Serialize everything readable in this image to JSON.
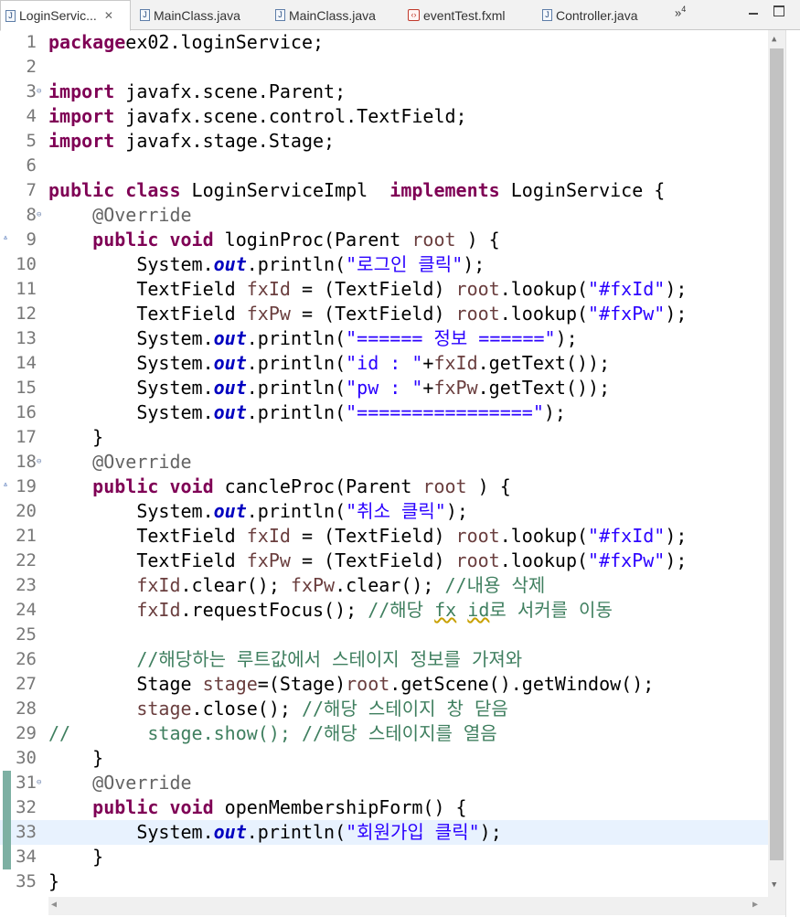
{
  "tabs": [
    {
      "label": "LoginServic...",
      "icon": "java-file-icon",
      "active": true,
      "close": "✕"
    },
    {
      "label": "MainClass.java",
      "icon": "java-file-icon"
    },
    {
      "label": "MainClass.java",
      "icon": "java-file-icon"
    },
    {
      "label": "eventTest.fxml",
      "icon": "fxml-file-icon"
    },
    {
      "label": "Controller.java",
      "icon": "java-file-icon"
    }
  ],
  "overflow_count": "4",
  "editor": {
    "current_line": 33,
    "lines": [
      {
        "n": "1",
        "code": [
          [
            "kw",
            "package"
          ],
          [
            "",
            "ex02.loginService;"
          ]
        ]
      },
      {
        "n": "2",
        "code": []
      },
      {
        "n": "3",
        "fold": true,
        "code": [
          [
            "kw",
            "import"
          ],
          [
            "",
            " javafx.scene.Parent;"
          ]
        ]
      },
      {
        "n": "4",
        "code": [
          [
            "kw",
            "import"
          ],
          [
            "",
            " javafx.scene.control.TextField;"
          ]
        ]
      },
      {
        "n": "5",
        "code": [
          [
            "kw",
            "import"
          ],
          [
            "",
            " javafx.stage.Stage;"
          ]
        ]
      },
      {
        "n": "6",
        "code": []
      },
      {
        "n": "7",
        "code": [
          [
            "kw",
            "public"
          ],
          [
            "",
            " "
          ],
          [
            "kw",
            "class"
          ],
          [
            "",
            " LoginServiceImpl  "
          ],
          [
            "kw",
            "implements"
          ],
          [
            "",
            " LoginService {"
          ]
        ]
      },
      {
        "n": "8",
        "fold": true,
        "code": [
          [
            "",
            "    "
          ],
          [
            "ann",
            "@Override"
          ]
        ]
      },
      {
        "n": "9",
        "override": true,
        "code": [
          [
            "",
            "    "
          ],
          [
            "kw",
            "public"
          ],
          [
            "",
            " "
          ],
          [
            "kw",
            "void"
          ],
          [
            "",
            " loginProc(Parent "
          ],
          [
            "var",
            "root"
          ],
          [
            "",
            " ) {"
          ]
        ]
      },
      {
        "n": "10",
        "code": [
          [
            "",
            "        System."
          ],
          [
            "fld",
            "out"
          ],
          [
            "",
            ".println("
          ],
          [
            "str",
            "\"로그인 클릭\""
          ],
          [
            "",
            ");"
          ]
        ]
      },
      {
        "n": "11",
        "code": [
          [
            "",
            "        TextField "
          ],
          [
            "var",
            "fxId"
          ],
          [
            "",
            " = (TextField) "
          ],
          [
            "var",
            "root"
          ],
          [
            "",
            ".lookup("
          ],
          [
            "str",
            "\"#fxId\""
          ],
          [
            "",
            ");"
          ]
        ]
      },
      {
        "n": "12",
        "code": [
          [
            "",
            "        TextField "
          ],
          [
            "var",
            "fxPw"
          ],
          [
            "",
            " = (TextField) "
          ],
          [
            "var",
            "root"
          ],
          [
            "",
            ".lookup("
          ],
          [
            "str",
            "\"#fxPw\""
          ],
          [
            "",
            ");"
          ]
        ]
      },
      {
        "n": "13",
        "code": [
          [
            "",
            "        System."
          ],
          [
            "fld",
            "out"
          ],
          [
            "",
            ".println("
          ],
          [
            "str",
            "\"====== 정보 ======\""
          ],
          [
            "",
            ");"
          ]
        ]
      },
      {
        "n": "14",
        "code": [
          [
            "",
            "        System."
          ],
          [
            "fld",
            "out"
          ],
          [
            "",
            ".println("
          ],
          [
            "str",
            "\"id : \""
          ],
          [
            "",
            "+"
          ],
          [
            "var",
            "fxId"
          ],
          [
            "",
            ".getText());"
          ]
        ]
      },
      {
        "n": "15",
        "code": [
          [
            "",
            "        System."
          ],
          [
            "fld",
            "out"
          ],
          [
            "",
            ".println("
          ],
          [
            "str",
            "\"pw : \""
          ],
          [
            "",
            "+"
          ],
          [
            "var",
            "fxPw"
          ],
          [
            "",
            ".getText());"
          ]
        ]
      },
      {
        "n": "16",
        "code": [
          [
            "",
            "        System."
          ],
          [
            "fld",
            "out"
          ],
          [
            "",
            ".println("
          ],
          [
            "str",
            "\"================\""
          ],
          [
            "",
            ");"
          ]
        ]
      },
      {
        "n": "17",
        "code": [
          [
            "",
            "    }"
          ]
        ]
      },
      {
        "n": "18",
        "fold": true,
        "code": [
          [
            "",
            "    "
          ],
          [
            "ann",
            "@Override"
          ]
        ]
      },
      {
        "n": "19",
        "override": true,
        "code": [
          [
            "",
            "    "
          ],
          [
            "kw",
            "public"
          ],
          [
            "",
            " "
          ],
          [
            "kw",
            "void"
          ],
          [
            "",
            " cancleProc(Parent "
          ],
          [
            "var",
            "root"
          ],
          [
            "",
            " ) {"
          ]
        ]
      },
      {
        "n": "20",
        "code": [
          [
            "",
            "        System."
          ],
          [
            "fld",
            "out"
          ],
          [
            "",
            ".println("
          ],
          [
            "str",
            "\"취소 클릭\""
          ],
          [
            "",
            ");"
          ]
        ]
      },
      {
        "n": "21",
        "code": [
          [
            "",
            "        TextField "
          ],
          [
            "var",
            "fxId"
          ],
          [
            "",
            " = (TextField) "
          ],
          [
            "var",
            "root"
          ],
          [
            "",
            ".lookup("
          ],
          [
            "str",
            "\"#fxId\""
          ],
          [
            "",
            ");"
          ]
        ]
      },
      {
        "n": "22",
        "code": [
          [
            "",
            "        TextField "
          ],
          [
            "var",
            "fxPw"
          ],
          [
            "",
            " = (TextField) "
          ],
          [
            "var",
            "root"
          ],
          [
            "",
            ".lookup("
          ],
          [
            "str",
            "\"#fxPw\""
          ],
          [
            "",
            ");"
          ]
        ]
      },
      {
        "n": "23",
        "code": [
          [
            "",
            "        "
          ],
          [
            "var",
            "fxId"
          ],
          [
            "",
            ".clear(); "
          ],
          [
            "var",
            "fxPw"
          ],
          [
            "",
            ".clear(); "
          ],
          [
            "cmt",
            "//내용 삭제"
          ]
        ]
      },
      {
        "n": "24",
        "code": [
          [
            "",
            "        "
          ],
          [
            "var",
            "fxId"
          ],
          [
            "",
            ".requestFocus(); "
          ],
          [
            "cmt",
            "//해당 "
          ],
          [
            "cmt squig",
            "fx"
          ],
          [
            "cmt",
            " "
          ],
          [
            "cmt squig",
            "id"
          ],
          [
            "cmt",
            "로 서커를 이동"
          ]
        ]
      },
      {
        "n": "25",
        "code": []
      },
      {
        "n": "26",
        "code": [
          [
            "",
            "        "
          ],
          [
            "cmt",
            "//해당하는 루트값에서 스테이지 정보를 가져와"
          ]
        ]
      },
      {
        "n": "27",
        "code": [
          [
            "",
            "        Stage "
          ],
          [
            "var",
            "stage"
          ],
          [
            "",
            "=(Stage)"
          ],
          [
            "var",
            "root"
          ],
          [
            "",
            ".getScene().getWindow();"
          ]
        ]
      },
      {
        "n": "28",
        "code": [
          [
            "",
            "        "
          ],
          [
            "var",
            "stage"
          ],
          [
            "",
            ".close(); "
          ],
          [
            "cmt",
            "//해당 스테이지 창 닫음"
          ]
        ]
      },
      {
        "n": "29",
        "code": [
          [
            "cmt",
            "//       stage.show(); //해당 스테이지를 열음"
          ]
        ]
      },
      {
        "n": "30",
        "code": [
          [
            "",
            "    }"
          ]
        ]
      },
      {
        "n": "31",
        "fold": true,
        "mark": true,
        "code": [
          [
            "",
            "    "
          ],
          [
            "ann",
            "@Override"
          ]
        ]
      },
      {
        "n": "32",
        "mark": true,
        "code": [
          [
            "",
            "    "
          ],
          [
            "kw",
            "public"
          ],
          [
            "",
            " "
          ],
          [
            "kw",
            "void"
          ],
          [
            "",
            " openMembershipForm() {"
          ]
        ]
      },
      {
        "n": "33",
        "mark": true,
        "code": [
          [
            "",
            "        System."
          ],
          [
            "fld",
            "out"
          ],
          [
            "",
            ".println("
          ],
          [
            "str",
            "\"회원가입 클릭\""
          ],
          [
            "",
            ");"
          ]
        ]
      },
      {
        "n": "34",
        "mark": true,
        "code": [
          [
            "",
            "    }"
          ]
        ]
      },
      {
        "n": "35",
        "code": [
          [
            "",
            "}"
          ]
        ]
      }
    ]
  },
  "icons": {
    "fold": "fold-collapse-icon",
    "override": "override-marker-icon",
    "scroll_up": "scroll-up-arrow-icon",
    "scroll_down": "scroll-down-arrow-icon",
    "scroll_left": "scroll-left-arrow-icon",
    "scroll_right": "scroll-right-arrow-icon"
  },
  "colors": {
    "keyword": "#7f0055",
    "string": "#2a00ff",
    "comment": "#3f7f5f",
    "annotation": "#646464",
    "static_field": "#0000c0",
    "local_var": "#6a3e3e",
    "current_line_bg": "#e8f2fe"
  }
}
